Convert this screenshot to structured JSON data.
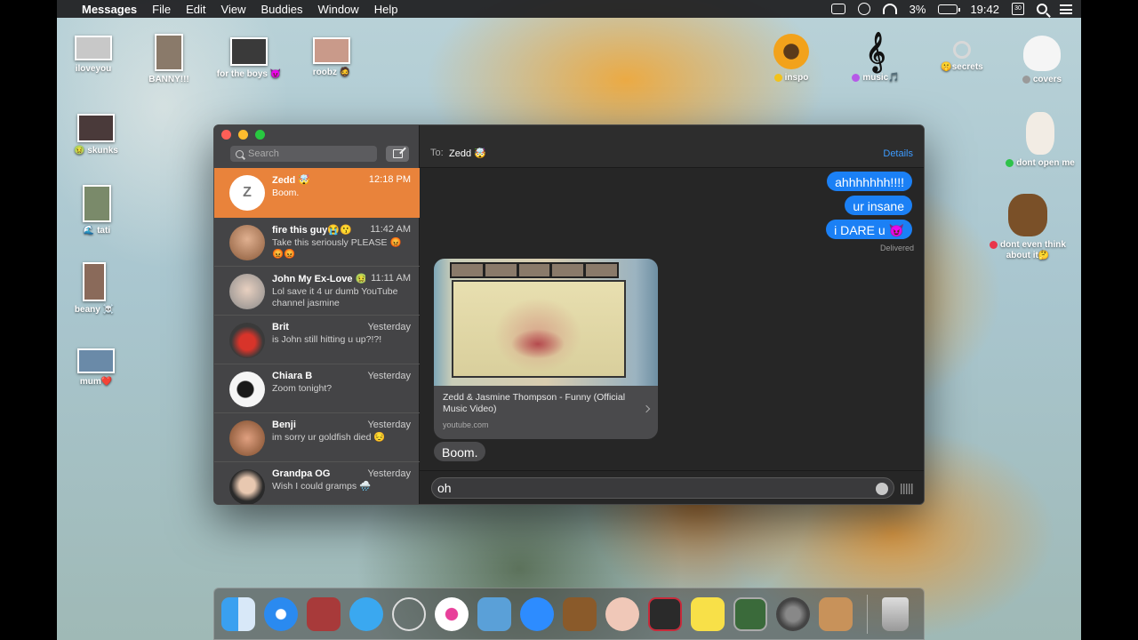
{
  "menubar": {
    "app": "Messages",
    "items": [
      "File",
      "Edit",
      "View",
      "Buddies",
      "Window",
      "Help"
    ],
    "battery": "3%",
    "clock": "19:42",
    "calendar_day": "30"
  },
  "desktop": {
    "left_icons": [
      {
        "label": "iloveyou"
      },
      {
        "label": "BANNY!!!"
      },
      {
        "label": "for the boys 😈"
      },
      {
        "label": "roobz 🧔"
      },
      {
        "label": "🤢 skunks"
      },
      {
        "label": "🌊 tati"
      },
      {
        "label": "beany ☠️"
      },
      {
        "label": "mum❤️"
      }
    ],
    "right_icons": [
      {
        "label": "inspo",
        "dot": "#f2c21b"
      },
      {
        "label": "music🎵",
        "dot": "#b659e8"
      },
      {
        "label": "🤫secrets",
        "dot": ""
      },
      {
        "label": "covers",
        "dot": "#9a9a9a"
      },
      {
        "label": "dont open me",
        "dot": "#2ec24a"
      },
      {
        "label": "dont even think about it🤔",
        "dot": "#e8364a"
      }
    ]
  },
  "sidebar": {
    "search_placeholder": "Search",
    "conversations": [
      {
        "name": "Zedd 🤯",
        "time": "12:18 PM",
        "preview": "Boom.",
        "avatar_letter": "Z"
      },
      {
        "name": "fire this guy😭😗",
        "time": "11:42 AM",
        "preview": "Take this seriously PLEASE 😡😡😡"
      },
      {
        "name": "John My Ex-Love 🤢...",
        "time": "11:11 AM",
        "preview": "Lol save it 4 ur dumb YouTube channel jasmine"
      },
      {
        "name": "Brit",
        "time": "Yesterday",
        "preview": "is John still hitting u up?!?!"
      },
      {
        "name": "Chiara B",
        "time": "Yesterday",
        "preview": "Zoom tonight?"
      },
      {
        "name": "Benji",
        "time": "Yesterday",
        "preview": "im sorry ur goldfish died 😔"
      },
      {
        "name": "Grandpa OG",
        "time": "Yesterday",
        "preview": "Wish I could gramps 🌧️"
      }
    ]
  },
  "chat": {
    "to_label": "To:",
    "to_name": "Zedd 🤯",
    "details_label": "Details",
    "outgoing": [
      "ahhhhhhh!!!!",
      "ur insane",
      "i DARE u 😈"
    ],
    "delivered_label": "Delivered",
    "link": {
      "title": "Zedd & Jasmine Thompson - Funny (Official Music Video)",
      "domain": "youtube.com"
    },
    "incoming_last": "Boom.",
    "input_value": "oh"
  }
}
